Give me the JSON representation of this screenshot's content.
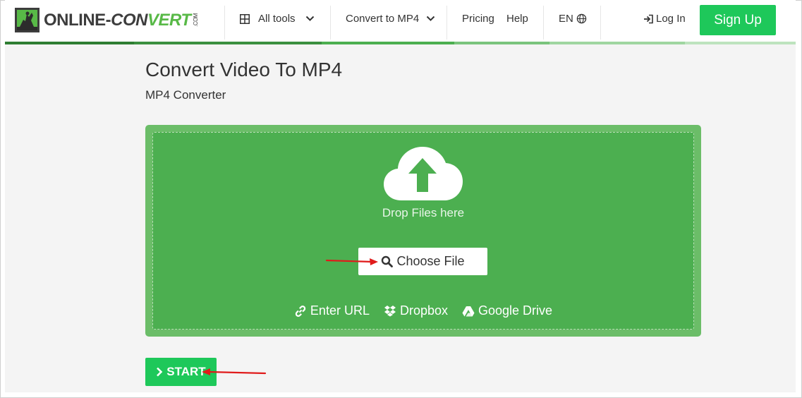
{
  "header": {
    "logo": {
      "part1": "ONLINE",
      "dash": "-",
      "part2": "CON",
      "part3": "VERT",
      "suffix": ".COM"
    },
    "nav": {
      "all_tools": "All tools",
      "convert_to": "Convert to MP4",
      "pricing": "Pricing",
      "help": "Help",
      "language": "EN",
      "login": "Log In",
      "signup": "Sign Up"
    }
  },
  "main": {
    "title": "Convert Video To MP4",
    "subtitle": "MP4 Converter",
    "dropzone": {
      "drop_text": "Drop Files here",
      "choose_file": "Choose File",
      "sources": [
        {
          "icon": "link-icon",
          "label": "Enter URL"
        },
        {
          "icon": "dropbox-icon",
          "label": "Dropbox"
        },
        {
          "icon": "google-drive-icon",
          "label": "Google Drive"
        }
      ]
    },
    "start_label": "START"
  },
  "colors": {
    "accent_green": "#1ec85a",
    "dropzone_green": "#4caf50",
    "dropzone_border": "#6bbd68",
    "annotation_red": "#e01b1b"
  }
}
